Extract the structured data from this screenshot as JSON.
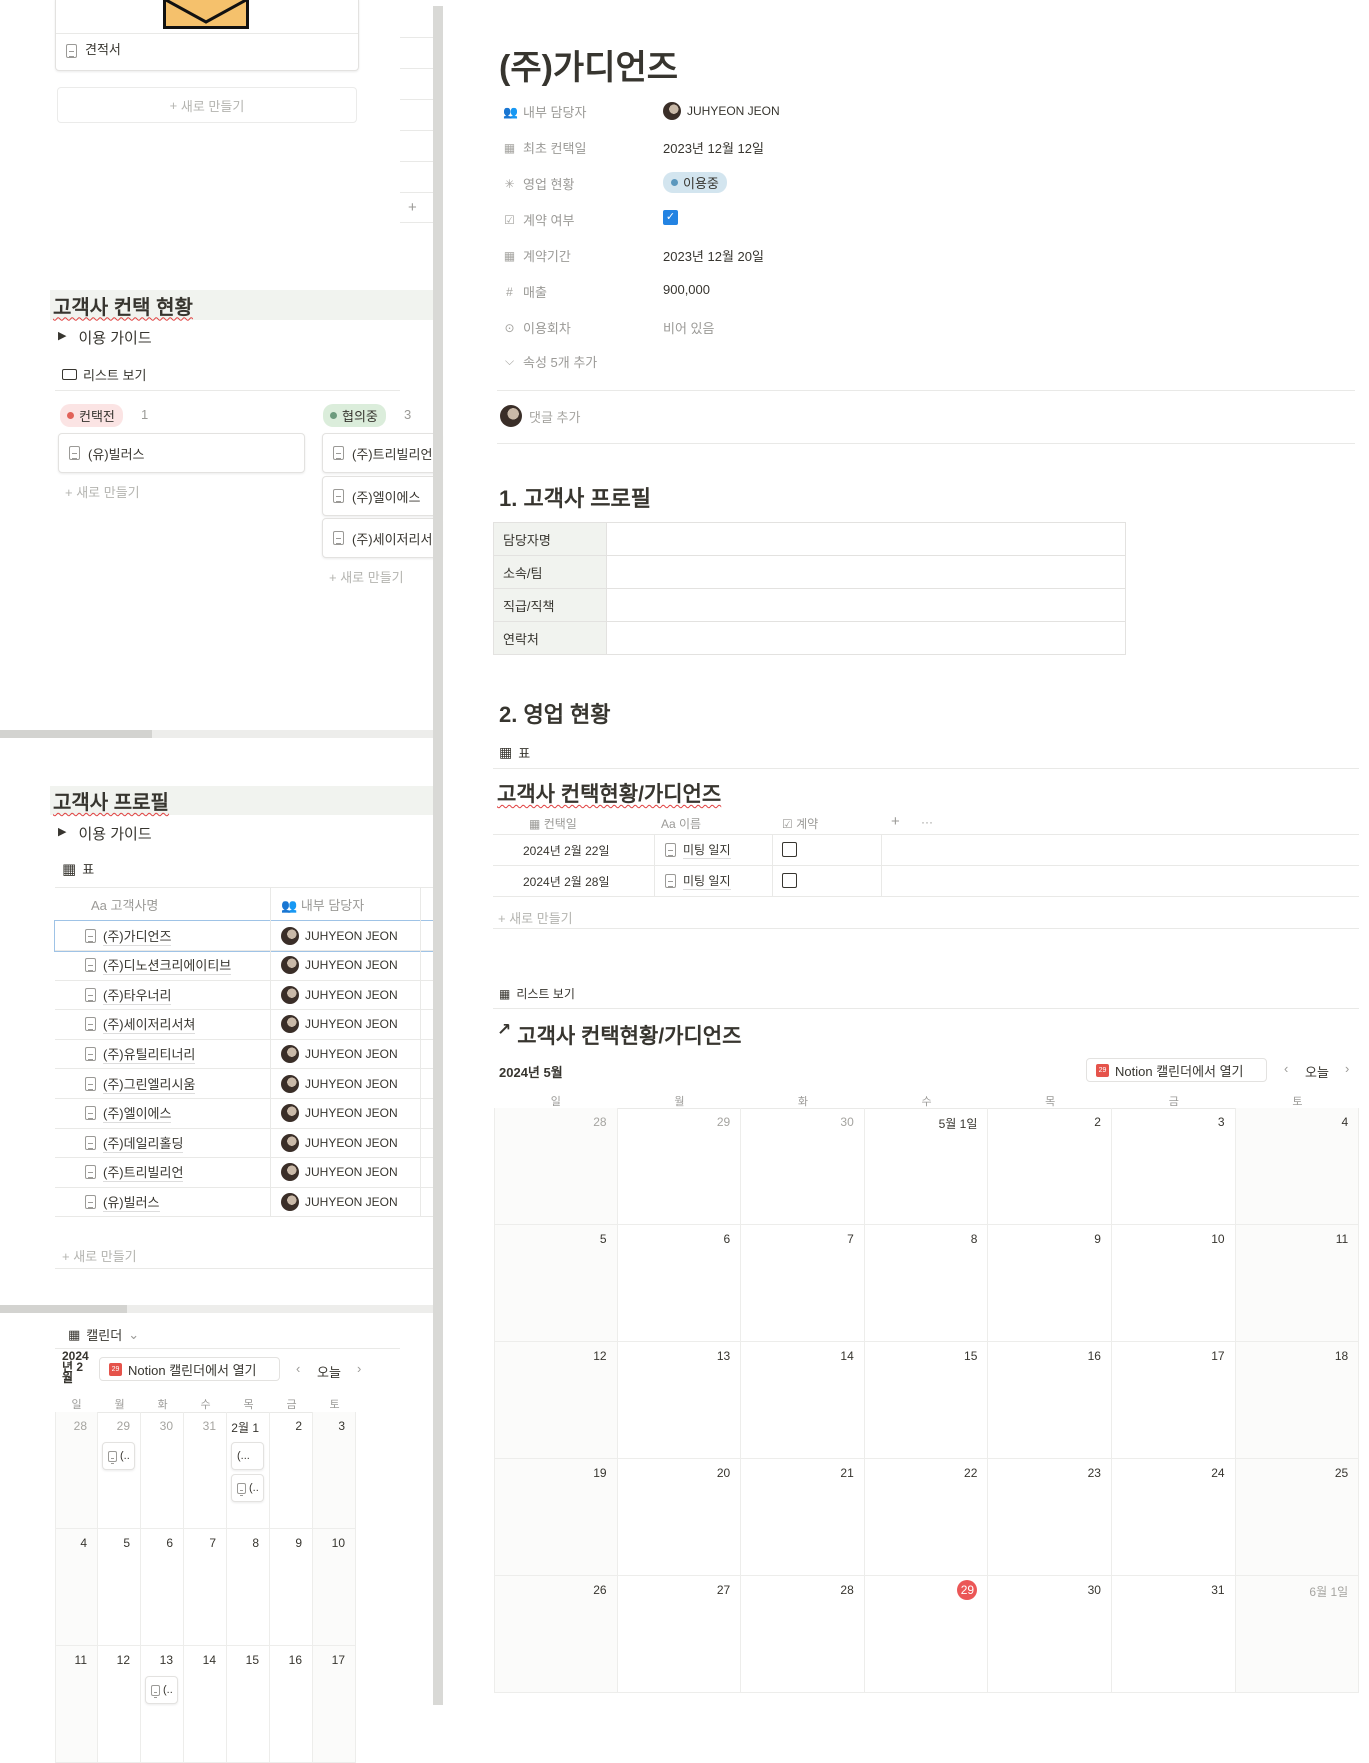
{
  "left": {
    "top_card": {
      "title": "견적서"
    },
    "top_new": "새로 만들기",
    "contact_section": {
      "heading": "고객사 컨택 현황",
      "guide": "이용 가이드",
      "view": "리스트 보기",
      "groups": [
        {
          "label": "컨택전",
          "count": "1",
          "color": "#e16259",
          "bg": "#fbe4e4",
          "items": [
            "(유)빌러스"
          ],
          "new": "새로 만들기"
        },
        {
          "label": "협의중",
          "count": "3",
          "color": "#6c9b7d",
          "bg": "#dbeddb",
          "items": [
            "(주)트리빌리언",
            "(주)엘이에스",
            "(주)세이저리서쳐"
          ],
          "new": "새로 만들기"
        }
      ]
    },
    "profile_section": {
      "heading": "고객사 프로필",
      "guide": "이용 가이드",
      "view": "표",
      "columns": [
        "고객사명",
        "내부 담당자"
      ],
      "column_icons": [
        "Aa",
        "people-icon"
      ],
      "rows": [
        {
          "name": "(주)가디언즈",
          "owner": "JUHYEON JEON"
        },
        {
          "name": "(주)디노션크리에이티브",
          "owner": "JUHYEON JEON"
        },
        {
          "name": "(주)타우너리",
          "owner": "JUHYEON JEON"
        },
        {
          "name": "(주)세이저리서쳐",
          "owner": "JUHYEON JEON"
        },
        {
          "name": "(주)유틸리티너리",
          "owner": "JUHYEON JEON"
        },
        {
          "name": "(주)그린엘리시움",
          "owner": "JUHYEON JEON"
        },
        {
          "name": "(주)엘이에스",
          "owner": "JUHYEON JEON"
        },
        {
          "name": "(주)데일리홀딩",
          "owner": "JUHYEON JEON"
        },
        {
          "name": "(주)트리빌리언",
          "owner": "JUHYEON JEON"
        },
        {
          "name": "(유)빌러스",
          "owner": "JUHYEON JEON"
        }
      ],
      "new": "새로 만들기"
    },
    "calendar": {
      "view": "캘린더",
      "month": "2024년 2월",
      "open_button": "Notion 캘린더에서 열기",
      "today": "오늘",
      "weekdays": [
        "일",
        "월",
        "화",
        "수",
        "목",
        "금",
        "토"
      ],
      "weeks": [
        [
          "28",
          "29",
          "30",
          "31",
          "2월 1",
          "2",
          "3"
        ],
        [
          "4",
          "5",
          "6",
          "7",
          "8",
          "9",
          "10"
        ],
        [
          "11",
          "12",
          "13",
          "14",
          "15",
          "16",
          "17"
        ]
      ],
      "events": [
        {
          "week": 0,
          "day": 1,
          "text": "(..",
          "icon": true
        },
        {
          "week": 0,
          "day": 4,
          "text": "(...",
          "icon": false
        },
        {
          "week": 0,
          "day": 4,
          "text": "(..",
          "icon": true
        },
        {
          "week": 2,
          "day": 2,
          "text": "(..",
          "icon": true
        }
      ]
    }
  },
  "page": {
    "title": "(주)가디언즈",
    "properties": [
      {
        "icon": "people-icon",
        "glyph": "👥",
        "label": "내부 담당자",
        "value": "JUHYEON JEON",
        "type": "person"
      },
      {
        "icon": "calendar-icon",
        "glyph": "▦",
        "label": "최초 컨택일",
        "value": "2023년 12월 12일",
        "type": "text"
      },
      {
        "icon": "status-icon",
        "glyph": "✳",
        "label": "영업 현황",
        "value": "이용중",
        "type": "status",
        "color": "#5b97bd",
        "bg": "#d3e5ef"
      },
      {
        "icon": "checkbox-icon",
        "glyph": "☑",
        "label": "계약 여부",
        "value": true,
        "type": "checkbox"
      },
      {
        "icon": "calendar-icon",
        "glyph": "▦",
        "label": "계약기간",
        "value": "2023년 12월 20일",
        "type": "text"
      },
      {
        "icon": "hash-icon",
        "glyph": "#",
        "label": "매출",
        "value": "900,000",
        "type": "text"
      },
      {
        "icon": "select-icon",
        "glyph": "⊙",
        "label": "이용회차",
        "value": "비어 있음",
        "type": "empty"
      }
    ],
    "more_properties": "속성 5개 추가",
    "comment_placeholder": "댓글 추가",
    "section1": {
      "heading": "1. 고객사 프로필",
      "rows": [
        "담당자명",
        "소속/팀",
        "직급/직책",
        "연락처"
      ]
    },
    "section2": {
      "heading": "2. 영업 현황",
      "view": "표",
      "db_title": "고객사 컨택현황/가디언즈",
      "columns": [
        "컨택일",
        "이름",
        "계약"
      ],
      "rows": [
        {
          "date": "2024년 2월 22일",
          "name": "미팅 일지",
          "contract": false
        },
        {
          "date": "2024년 2월 28일",
          "name": "미팅 일지",
          "contract": false
        }
      ],
      "new": "새로 만들기"
    },
    "calendar": {
      "view": "리스트 보기",
      "title": "고객사 컨택현황/가디언즈",
      "month": "2024년 5월",
      "open_button": "Notion 캘린더에서 열기",
      "today": "오늘",
      "weekdays": [
        "일",
        "월",
        "화",
        "수",
        "목",
        "금",
        "토"
      ],
      "weeks": [
        [
          "28",
          "29",
          "30",
          "5월 1일",
          "2",
          "3",
          "4"
        ],
        [
          "5",
          "6",
          "7",
          "8",
          "9",
          "10",
          "11"
        ],
        [
          "12",
          "13",
          "14",
          "15",
          "16",
          "17",
          "18"
        ],
        [
          "19",
          "20",
          "21",
          "22",
          "23",
          "24",
          "25"
        ],
        [
          "26",
          "27",
          "28",
          "29",
          "30",
          "31",
          "6월 1일"
        ]
      ],
      "today_date": "29",
      "today_color": "#eb5757"
    }
  }
}
